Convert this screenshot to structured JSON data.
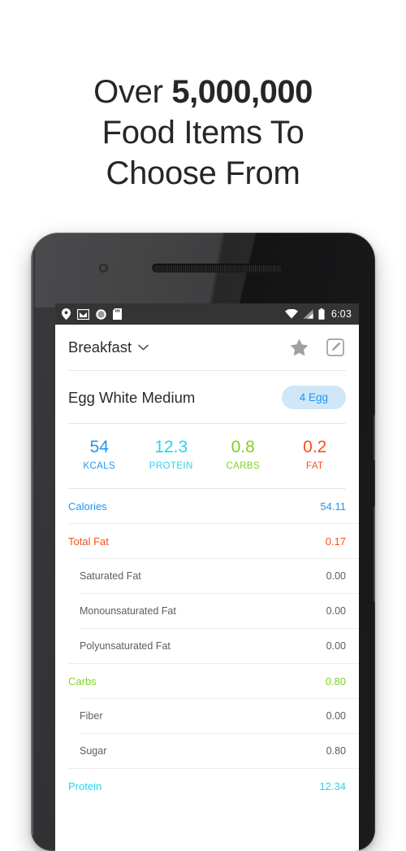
{
  "headline": {
    "line1_prefix": "Over ",
    "line1_strong": "5,000,000",
    "line2": "Food Items To",
    "line3": "Choose From"
  },
  "phone": {
    "status_bar": {
      "icons_left": [
        "location-pin-icon",
        "gmail-icon",
        "circle-icon",
        "sd-card-icon"
      ],
      "icons_right": [
        "wifi-icon",
        "cell-signal-icon",
        "battery-icon"
      ],
      "time": "6:03"
    },
    "app_bar": {
      "meal": "Breakfast",
      "dropdown_icon": "chevron-down-icon",
      "favorite_icon": "star-icon",
      "edit_icon": "edit-icon"
    },
    "food": {
      "name": "Egg White Medium",
      "serving": "4 Egg"
    },
    "macros": [
      {
        "value": "54",
        "label": "KCALS",
        "color": "#2196f3"
      },
      {
        "value": "12.3",
        "label": "PROTEIN",
        "color": "#25d5ee"
      },
      {
        "value": "0.8",
        "label": "CARBS",
        "color": "#7ed321"
      },
      {
        "value": "0.2",
        "label": "FAT",
        "color": "#f4511e"
      }
    ],
    "nutrition": [
      {
        "label": "Calories",
        "value": "54.11",
        "color": "#2196f3",
        "sub": false
      },
      {
        "label": "Total Fat",
        "value": "0.17",
        "color": "#f4511e",
        "sub": false
      },
      {
        "label": "Saturated Fat",
        "value": "0.00",
        "color": "#5c5c5c",
        "sub": true
      },
      {
        "label": "Monounsaturated Fat",
        "value": "0.00",
        "color": "#5c5c5c",
        "sub": true
      },
      {
        "label": "Polyunsaturated Fat",
        "value": "0.00",
        "color": "#5c5c5c",
        "sub": true
      },
      {
        "label": "Carbs",
        "value": "0.80",
        "color": "#7ed321",
        "sub": false
      },
      {
        "label": "Fiber",
        "value": "0.00",
        "color": "#5c5c5c",
        "sub": true
      },
      {
        "label": "Sugar",
        "value": "0.80",
        "color": "#5c5c5c",
        "sub": true
      },
      {
        "label": "Protein",
        "value": "12.34",
        "color": "#25d5ee",
        "sub": false
      }
    ]
  }
}
